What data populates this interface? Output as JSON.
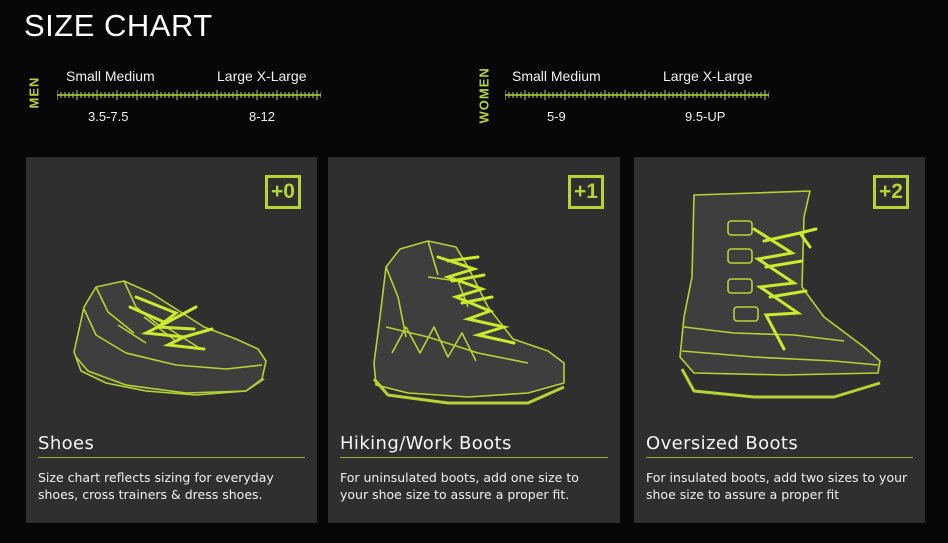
{
  "page": {
    "title": "SIZE CHART"
  },
  "scales": {
    "men": {
      "label": "MEN",
      "groups": [
        {
          "label": "Small Medium",
          "range": "3.5-7.5"
        },
        {
          "label": "Large X-Large",
          "range": "8-12"
        }
      ]
    },
    "women": {
      "label": "WOMEN",
      "groups": [
        {
          "label": "Small Medium",
          "range": "5-9"
        },
        {
          "label": "Large X-Large",
          "range": "9.5-UP"
        }
      ]
    }
  },
  "panels": [
    {
      "badge": "+0",
      "title": "Shoes",
      "description": "Size chart reflects sizing for everyday shoes, cross trainers & dress shoes.",
      "icon": "shoe-icon"
    },
    {
      "badge": "+1",
      "title": "Hiking/Work Boots",
      "description": "For uninsulated boots, add one size to your shoe size to assure a proper fit.",
      "icon": "hiking-boot-icon"
    },
    {
      "badge": "+2",
      "title": "Oversized Boots",
      "description": "For insulated boots, add two sizes to your shoe size to assure a proper fit",
      "icon": "insulated-boot-icon"
    }
  ],
  "colors": {
    "accent": "#b5d334",
    "panel": "#2f2f2f",
    "background": "#070707"
  }
}
